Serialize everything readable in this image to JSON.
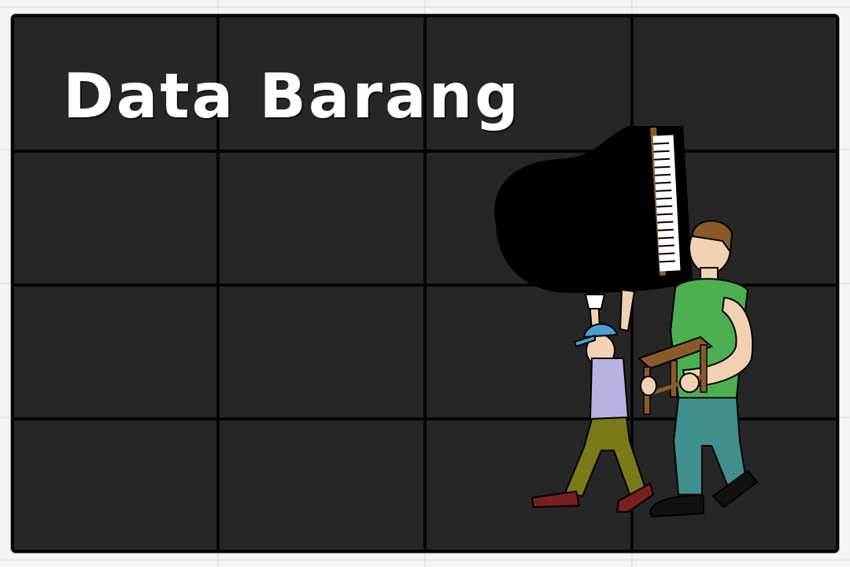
{
  "slide": {
    "title": "Data Barang"
  },
  "illustration": {
    "subject": "movers-carrying-piano-and-stool"
  },
  "colors": {
    "board_background": "#262626",
    "grid_lines": "#050505",
    "title_text": "#ffffff",
    "mover_shirt_green": "#4caf50",
    "mover_pants_teal": "#3f8f8c",
    "helper_shirt_lavender": "#b8b2e0",
    "helper_pants_olive": "#7a7a18",
    "helper_cap_blue": "#4a9fd6",
    "shoes_maroon": "#7a1f1f",
    "stool_wood": "#8a5a2b",
    "piano_body": "#000000"
  }
}
